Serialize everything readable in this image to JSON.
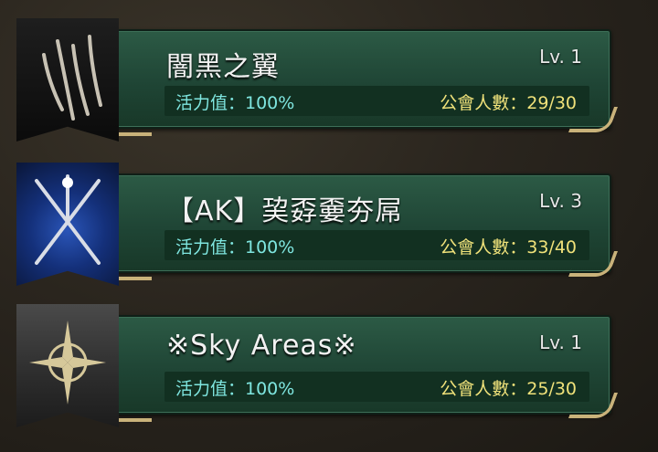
{
  "guilds": [
    {
      "name": "闇黑之翼",
      "level": "Lv. 1",
      "vitality": "活力值：100%",
      "members": "公會人數：29/30",
      "emblem": "claw-marks-icon"
    },
    {
      "name": "【AK】巭孬嫑夯屌",
      "level": "Lv. 3",
      "vitality": "活力值：100%",
      "members": "公會人數：33/40",
      "emblem": "crossed-swords-icon"
    },
    {
      "name": "※Sky Areas※",
      "level": "Lv. 1",
      "vitality": "活力值：100%",
      "members": "公會人數：25/30",
      "emblem": "compass-star-icon"
    }
  ],
  "colors": {
    "panel": "#1f4535",
    "vitality_text": "#7fe6e0",
    "members_text": "#f0e27a",
    "trim": "#c9b27a"
  }
}
